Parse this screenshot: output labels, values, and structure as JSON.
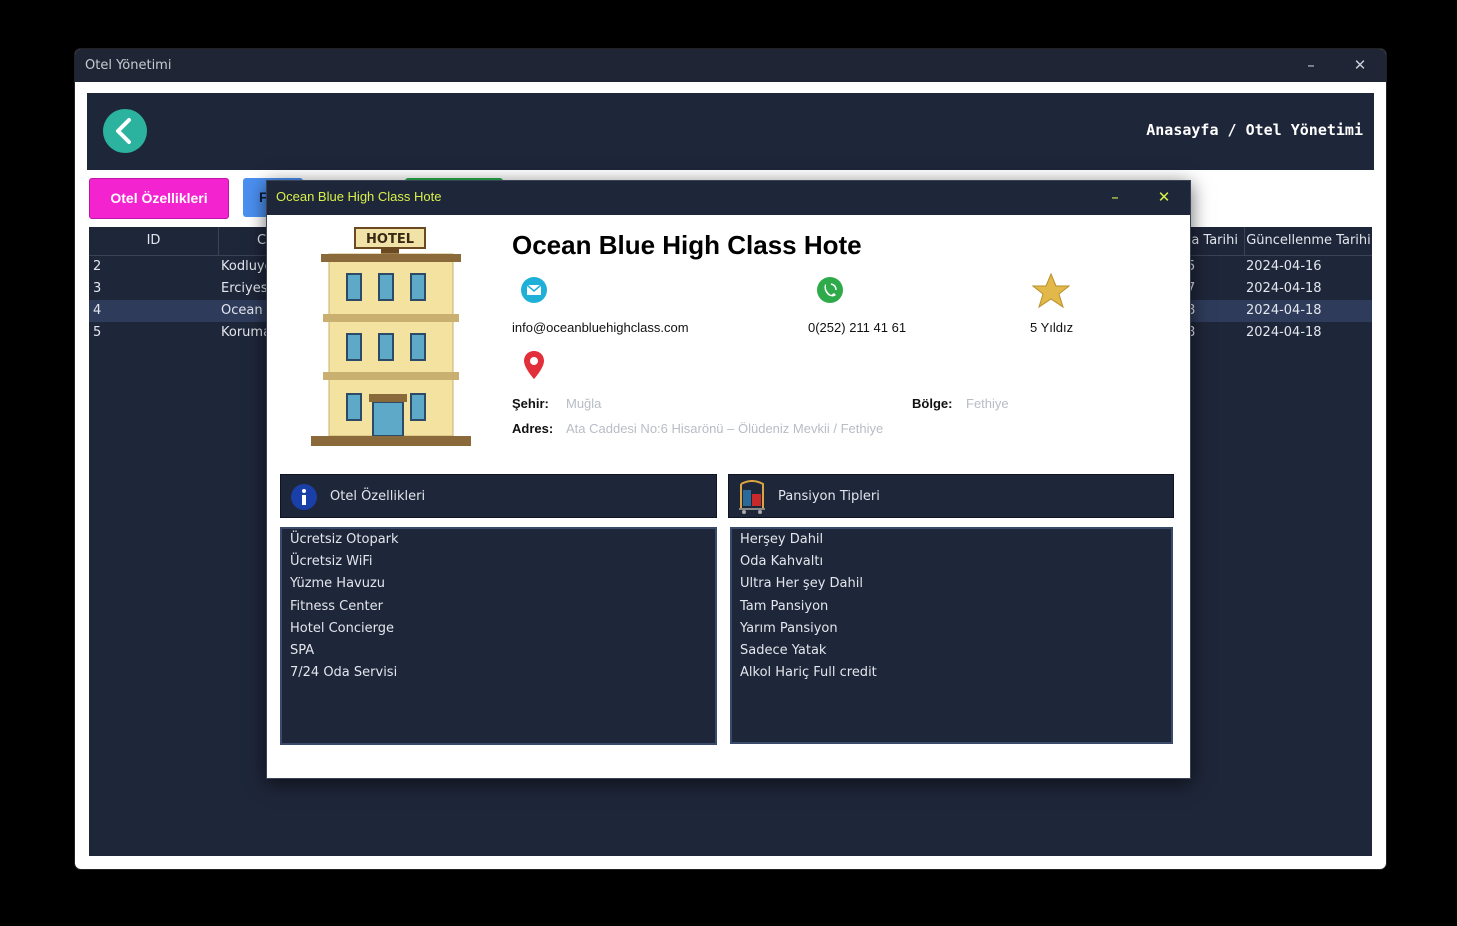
{
  "window": {
    "title": "Otel Yönetimi",
    "minimize": "–",
    "close": "✕"
  },
  "header": {
    "back_icon": "chevron-left-icon",
    "back_glyph": "‹",
    "breadcrumb": "Anasayfa / Otel Yönetimi"
  },
  "toolbar": {
    "features_label": "Otel Özellikleri",
    "second_label": "F"
  },
  "table": {
    "headers": [
      {
        "label": "ID"
      },
      {
        "label": "C"
      },
      {
        "label": "a Tarihi"
      },
      {
        "label": "Güncellenme Tarihi"
      }
    ],
    "rows": [
      {
        "id": "2",
        "name": "Kodluyo",
        "created": "5",
        "updated": "2024-04-16",
        "selected": false
      },
      {
        "id": "3",
        "name": "Erciyes",
        "created": "7",
        "updated": "2024-04-18",
        "selected": false
      },
      {
        "id": "4",
        "name": "Ocean I",
        "created": "8",
        "updated": "2024-04-18",
        "selected": true
      },
      {
        "id": "5",
        "name": "Koruma",
        "created": "8",
        "updated": "2024-04-18",
        "selected": false
      }
    ]
  },
  "dialog": {
    "title": "Ocean Blue High Class Hote",
    "minimize": "–",
    "close": "✕",
    "hotel_name": "Ocean Blue High Class Hote",
    "hotel_sign": "HOTEL",
    "email": "info@oceanbluehighclass.com",
    "phone": "0(252) 211 41 61",
    "stars": "5 Yıldız",
    "city_label": "Şehir:",
    "city": "Muğla",
    "region_label": "Bölge:",
    "region": "Fethiye",
    "address_label": "Adres:",
    "address": "Ata Caddesi No:6 Hisarönü – Ölüdeniz Mevkii / Fethiye",
    "features_title": "Otel Özellikleri",
    "features": [
      "Ücretsiz Otopark",
      "Ücretsiz WiFi",
      "Yüzme Havuzu",
      "Fitness Center",
      "Hotel Concierge",
      "SPA",
      "7/24 Oda Servisi"
    ],
    "pension_title": "Pansiyon Tipleri",
    "pensions": [
      "Herşey Dahil",
      "Oda Kahvaltı",
      "Ultra Her şey Dahil",
      "Tam Pansiyon",
      "Yarım Pansiyon",
      "Sadece Yatak",
      "Alkol Hariç Full credit"
    ]
  },
  "icons": {
    "email": "email-icon",
    "phone": "phone-icon",
    "star": "star-icon",
    "location": "location-pin-icon",
    "info": "info-icon",
    "luggage": "luggage-cart-icon",
    "hotel": "hotel-building-icon"
  },
  "colors": {
    "panel": "#1e2639",
    "accent_pink": "#f323cf",
    "accent_teal": "#2bb3a0",
    "dialog_title": "#d8f04a",
    "selected_row": "#2e3b5a"
  }
}
